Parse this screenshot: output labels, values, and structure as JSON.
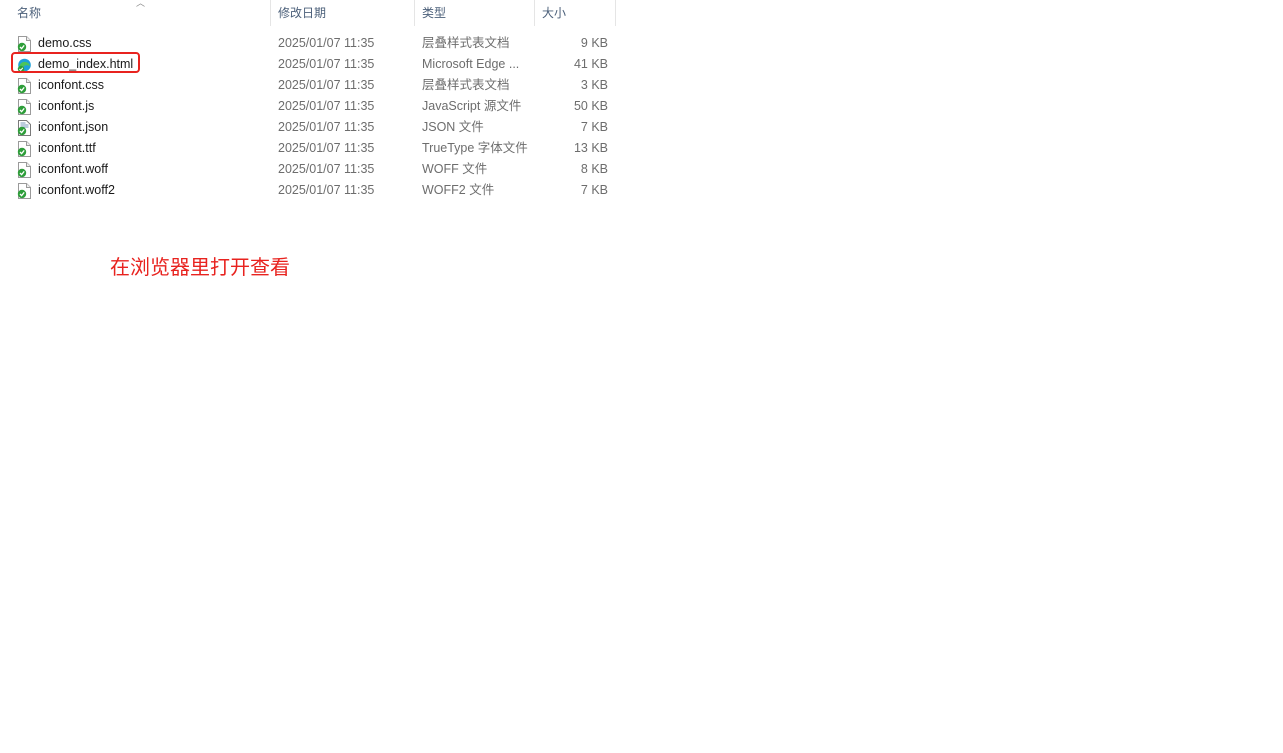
{
  "columns": {
    "name": "名称",
    "date": "修改日期",
    "type": "类型",
    "size": "大小"
  },
  "files": [
    {
      "name": "demo.css",
      "date": "2025/01/07 11:35",
      "type": "层叠样式表文档",
      "size": "9 KB",
      "icon": "css-file-icon"
    },
    {
      "name": "demo_index.html",
      "date": "2025/01/07 11:35",
      "type": "Microsoft Edge ...",
      "size": "41 KB",
      "icon": "edge-html-file-icon"
    },
    {
      "name": "iconfont.css",
      "date": "2025/01/07 11:35",
      "type": "层叠样式表文档",
      "size": "3 KB",
      "icon": "css-file-icon"
    },
    {
      "name": "iconfont.js",
      "date": "2025/01/07 11:35",
      "type": "JavaScript 源文件",
      "size": "50 KB",
      "icon": "js-file-icon"
    },
    {
      "name": "iconfont.json",
      "date": "2025/01/07 11:35",
      "type": "JSON 文件",
      "size": "7 KB",
      "icon": "json-file-icon"
    },
    {
      "name": "iconfont.ttf",
      "date": "2025/01/07 11:35",
      "type": "TrueType 字体文件",
      "size": "13 KB",
      "icon": "font-file-icon"
    },
    {
      "name": "iconfont.woff",
      "date": "2025/01/07 11:35",
      "type": "WOFF 文件",
      "size": "8 KB",
      "icon": "woff-file-icon"
    },
    {
      "name": "iconfont.woff2",
      "date": "2025/01/07 11:35",
      "type": "WOFF2 文件",
      "size": "7 KB",
      "icon": "woff2-file-icon"
    }
  ],
  "annotation": {
    "text": "在浏览器里打开查看",
    "color": "#e8231f"
  },
  "colors": {
    "header_text": "#4c607a",
    "secondary_text": "#6d6d6d",
    "highlight": "#e8231f",
    "check_green": "#2e9e3a"
  }
}
